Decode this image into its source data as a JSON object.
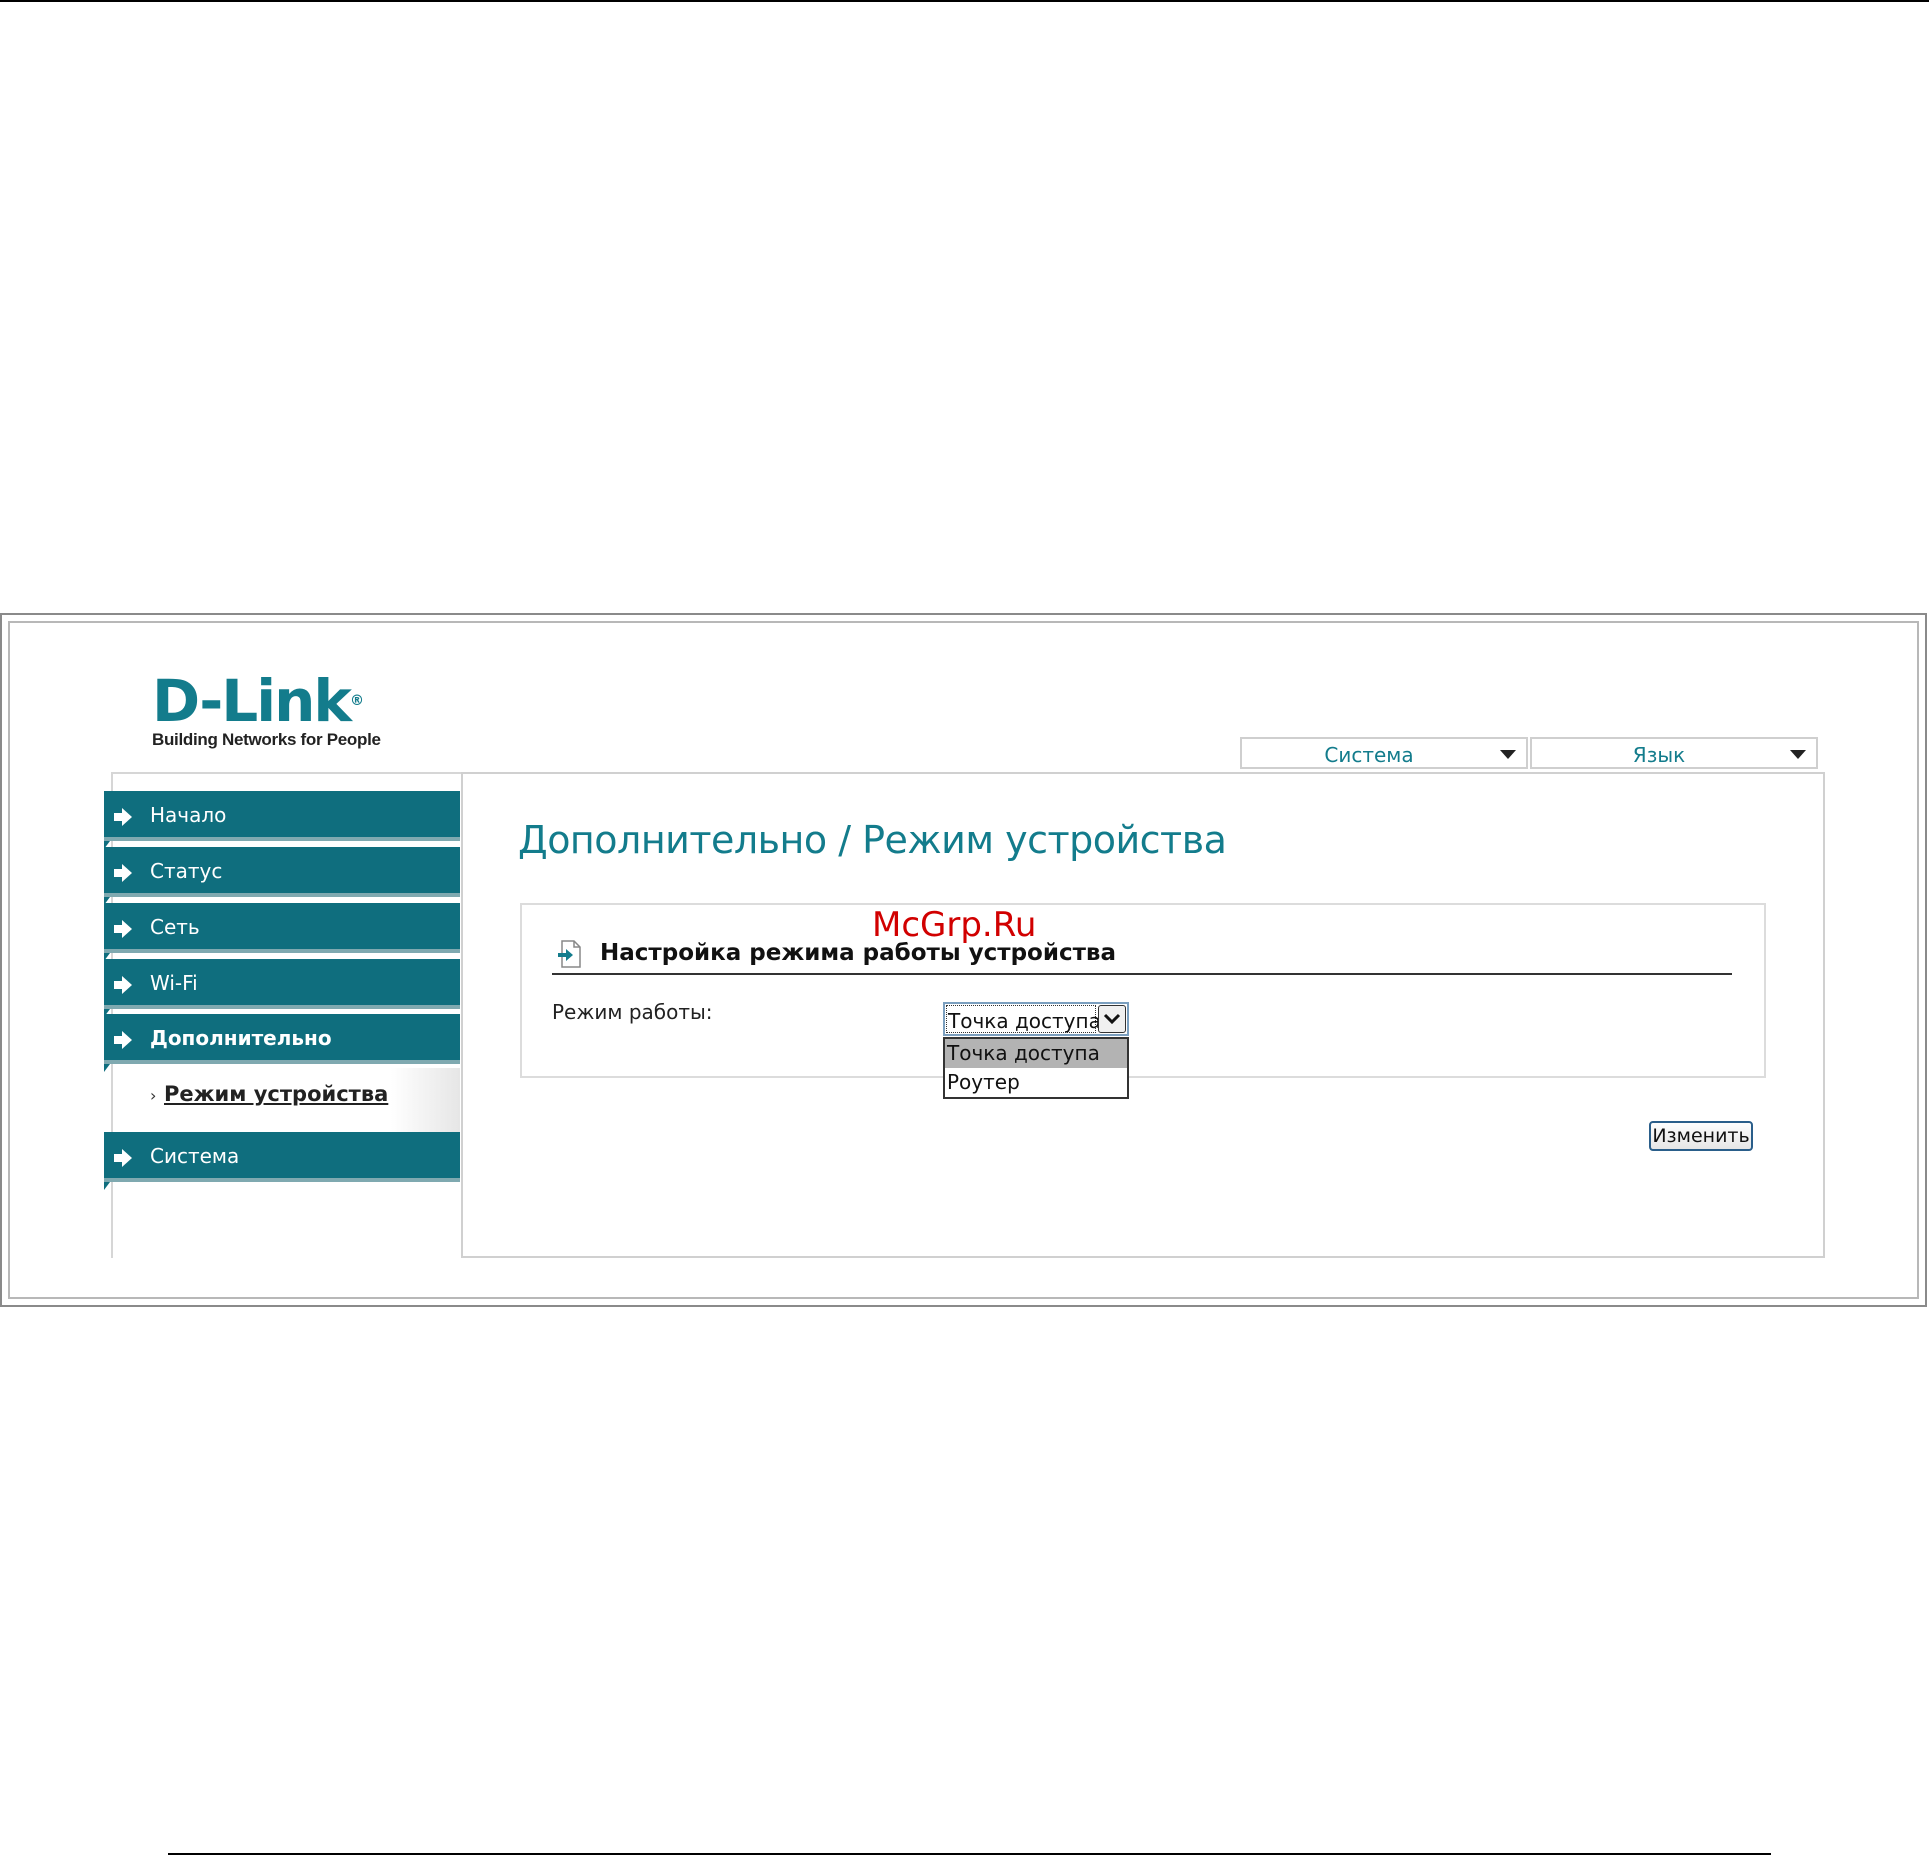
{
  "logo": {
    "brand": "D-Link",
    "reg_mark": "®",
    "tagline": "Building Networks for People"
  },
  "top_menu": [
    {
      "label": "Система"
    },
    {
      "label": "Язык"
    }
  ],
  "sidebar": {
    "items": [
      {
        "label": "Начало"
      },
      {
        "label": "Статус"
      },
      {
        "label": "Сеть"
      },
      {
        "label": "Wi-Fi"
      },
      {
        "label": "Дополнительно"
      },
      {
        "label": "Система"
      }
    ],
    "subitem": {
      "bullet": "›",
      "label": "Режим устройства"
    }
  },
  "main": {
    "title": "Дополнительно / Режим устройства",
    "section_title": "Настройка режима работы устройства",
    "field_label": "Режим работы:",
    "select_value": "Точка доступа",
    "options": [
      "Точка доступа",
      "Роутер"
    ],
    "apply_label": "Изменить"
  },
  "watermark": "McGrp.Ru",
  "colors": {
    "accent": "#137c8c",
    "nav_bg": "#0f6e7e",
    "watermark": "#d10000"
  }
}
